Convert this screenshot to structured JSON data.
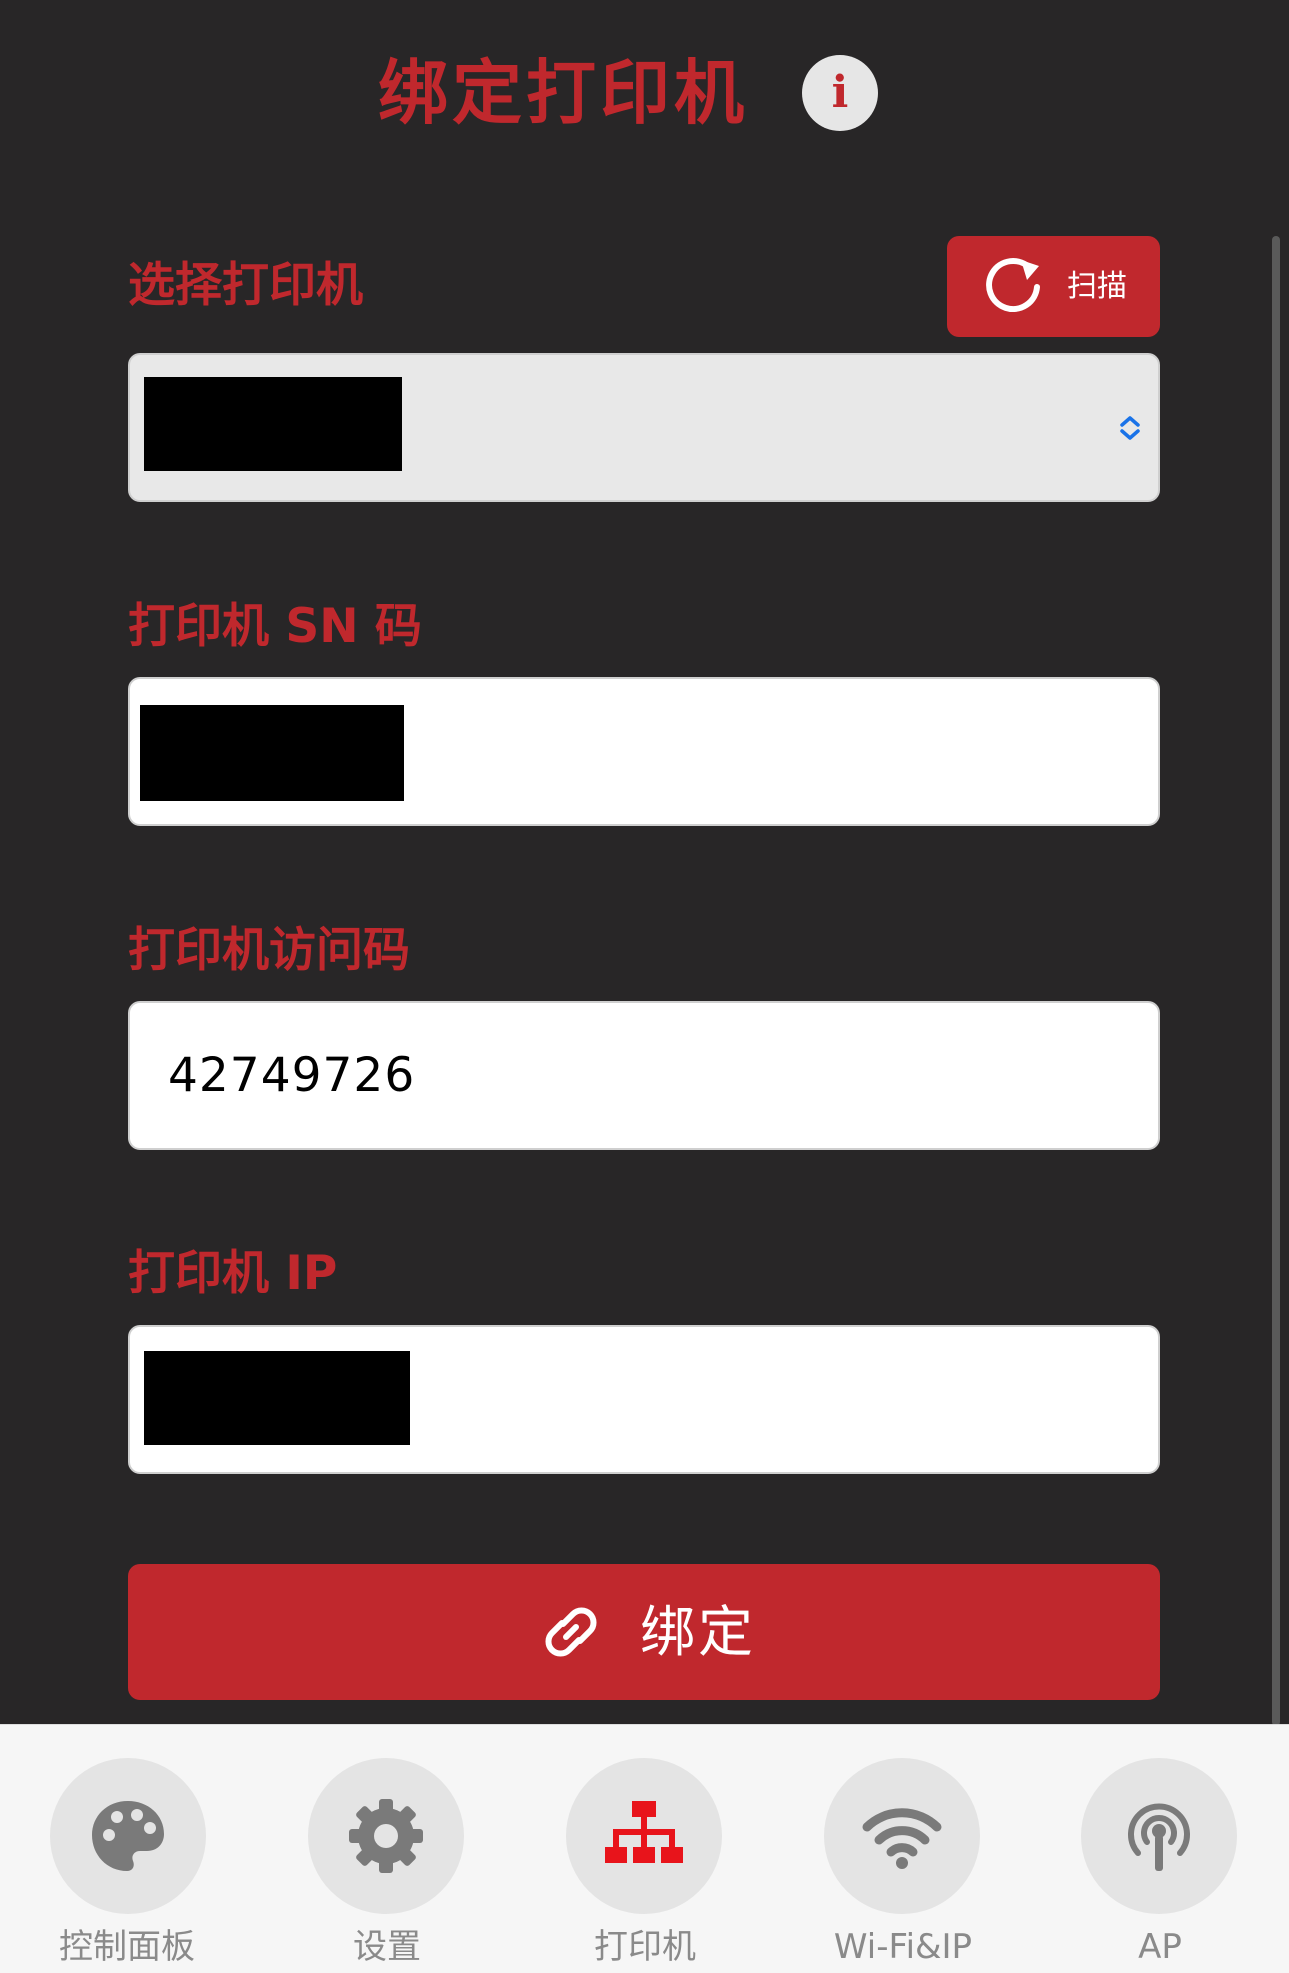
{
  "header": {
    "title": "绑定打印机",
    "info_glyph": "i"
  },
  "form": {
    "select_printer": {
      "label": "选择打印机",
      "scan_label": "扫描",
      "value_redacted": true
    },
    "sn": {
      "label": "打印机 SN 码",
      "value_redacted": true
    },
    "access_code": {
      "label": "打印机访问码",
      "value": "42749726"
    },
    "ip": {
      "label": "打印机 IP",
      "value_redacted": true
    },
    "bind_button_label": "绑定"
  },
  "tabs": [
    {
      "label": "控制面板",
      "icon": "palette-icon",
      "active": false
    },
    {
      "label": "设置",
      "icon": "gear-icon",
      "active": false
    },
    {
      "label": "打印机",
      "icon": "network-tree-icon",
      "active": true
    },
    {
      "label": "Wi-Fi&IP",
      "icon": "wifi-icon",
      "active": false
    },
    {
      "label": "AP",
      "icon": "antenna-icon",
      "active": false
    }
  ],
  "colors": {
    "background": "#282627",
    "accent": "#c0282d",
    "active_tab_icon": "#e8141b",
    "inactive_tab_icon": "#7a7a7a"
  }
}
